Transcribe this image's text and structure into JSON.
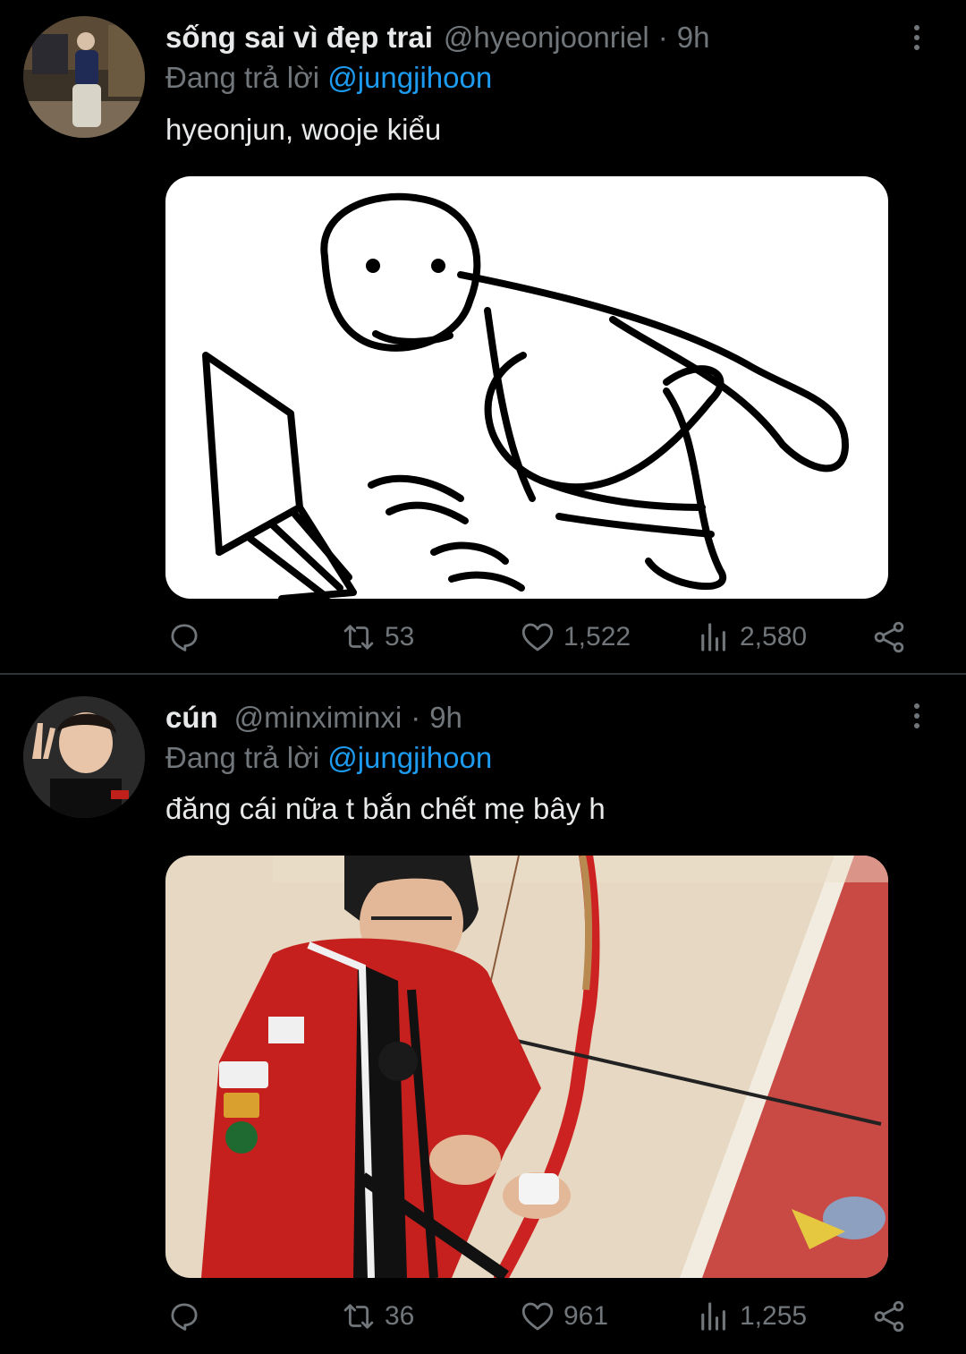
{
  "tweets": [
    {
      "display_name": "sống sai vì đẹp trai",
      "handle": "@hyeonjoonriel",
      "separator": "·",
      "time": "9h",
      "reply_prefix": "Đang trả lời",
      "reply_to": "@jungjihoon",
      "text": "hyeonjun, wooje kiểu",
      "media_description": "stick-figure-typing-on-laptop-drawing",
      "retweets": "53",
      "likes": "1,522",
      "views": "2,580"
    },
    {
      "display_name": "cún",
      "handle": "@minximinxi",
      "separator": "·",
      "time": "9h",
      "reply_prefix": "Đang trả lời",
      "reply_to": "@jungjihoon",
      "text": "đăng cái nữa t bắn chết mẹ bây h",
      "media_description": "person-in-red-jacket-with-archery-bow-photo",
      "retweets": "36",
      "likes": "961",
      "views": "1,255"
    }
  ],
  "icons": {
    "reply": "reply-bubble-icon",
    "retweet": "retweet-arrows-icon",
    "like": "heart-icon",
    "views": "bar-chart-icon",
    "share": "share-nodes-icon",
    "more": "vertical-dots-icon"
  },
  "colors": {
    "background": "#000000",
    "text_primary": "#e7e9ea",
    "text_secondary": "#71767b",
    "link": "#1d9bf0",
    "divider": "#2f3336"
  }
}
